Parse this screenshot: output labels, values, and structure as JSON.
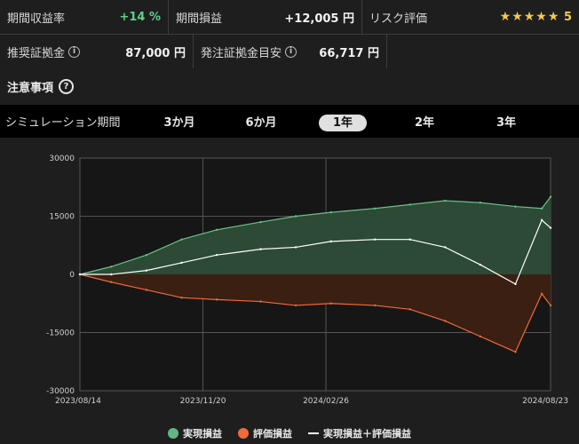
{
  "stats": {
    "period_return_label": "期間収益率",
    "period_return_value": "+14 %",
    "period_pnl_label": "期間損益",
    "period_pnl_value": "+12,005 円",
    "risk_label": "リスク評価",
    "risk_stars": "★★★★★",
    "risk_value": "5",
    "recommended_margin_label": "推奨証拠金",
    "recommended_margin_value": "87,000 円",
    "order_margin_label": "発注証拠金目安",
    "order_margin_value": "66,717 円"
  },
  "caution": {
    "label": "注意事項"
  },
  "period_selector": {
    "label": "シミュレーション期間",
    "options": [
      "3か月",
      "6か月",
      "1年",
      "2年",
      "3年"
    ],
    "selected": "1年"
  },
  "colors": {
    "realized": "#2c4a35",
    "realized_line": "#6bbf8a",
    "unrealized": "#3a1f12",
    "unrealized_line": "#f06a3c",
    "total": "#ffffff"
  },
  "chart_data": {
    "type": "area",
    "ylim": [
      -30000,
      30000
    ],
    "yticks": [
      "30000",
      "15000",
      "0",
      "-15000",
      "-30000"
    ],
    "xticks": [
      "2023/08/14",
      "2023/11/20",
      "2024/02/26",
      "2024/08/23"
    ],
    "grid": true,
    "legend_position": "bottom-center",
    "series": [
      {
        "name": "実現損益",
        "x": [
          "2023/08/14",
          "2023/09/08",
          "2023/10/06",
          "2023/11/03",
          "2023/12/01",
          "2024/01/05",
          "2024/02/02",
          "2024/03/01",
          "2024/04/05",
          "2024/05/03",
          "2024/05/31",
          "2024/06/28",
          "2024/07/26",
          "2024/08/16",
          "2024/08/23"
        ],
        "values": [
          0,
          2000,
          5000,
          9000,
          11500,
          13500,
          15000,
          16000,
          17000,
          18000,
          19000,
          18500,
          17500,
          17000,
          20000
        ]
      },
      {
        "name": "評価損益",
        "x": [
          "2023/08/14",
          "2023/09/08",
          "2023/10/06",
          "2023/11/03",
          "2023/12/01",
          "2024/01/05",
          "2024/02/02",
          "2024/03/01",
          "2024/04/05",
          "2024/05/03",
          "2024/05/31",
          "2024/06/28",
          "2024/07/26",
          "2024/08/16",
          "2024/08/23"
        ],
        "values": [
          0,
          -2000,
          -4000,
          -6000,
          -6500,
          -7000,
          -8000,
          -7500,
          -8000,
          -9000,
          -12000,
          -16000,
          -20000,
          -5000,
          -8000
        ]
      },
      {
        "name": "実現損益＋評価損益",
        "x": [
          "2023/08/14",
          "2023/09/08",
          "2023/10/06",
          "2023/11/03",
          "2023/12/01",
          "2024/01/05",
          "2024/02/02",
          "2024/03/01",
          "2024/04/05",
          "2024/05/03",
          "2024/05/31",
          "2024/06/28",
          "2024/07/26",
          "2024/08/16",
          "2024/08/23"
        ],
        "values": [
          0,
          0,
          1000,
          3000,
          5000,
          6500,
          7000,
          8500,
          9000,
          9000,
          7000,
          2500,
          -2500,
          14000,
          12000
        ]
      }
    ]
  }
}
